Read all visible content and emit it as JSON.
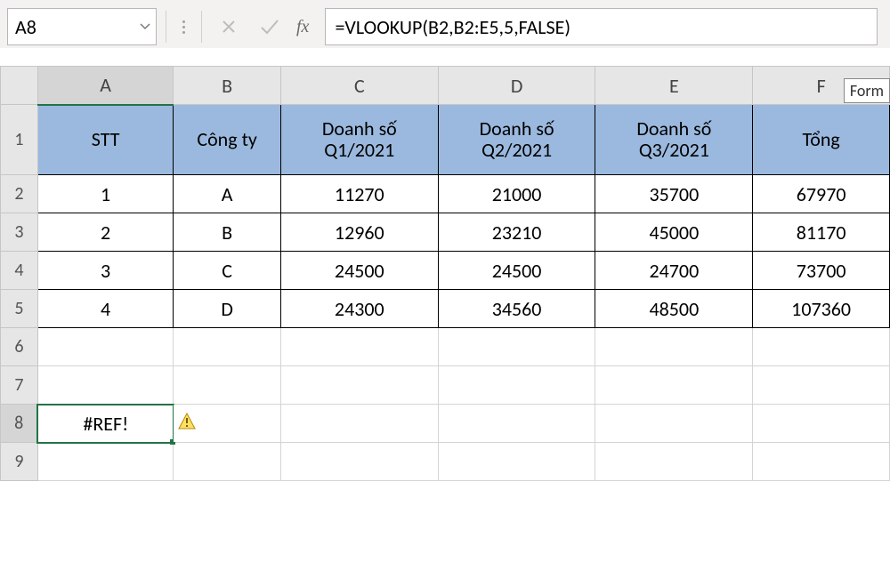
{
  "namebox": {
    "value": "A8"
  },
  "formula_bar": {
    "value": "=VLOOKUP(B2,B2:E5,5,FALSE)"
  },
  "floating_tag": "Form",
  "columns": [
    "A",
    "B",
    "C",
    "D",
    "E",
    "F"
  ],
  "row_numbers": [
    "1",
    "2",
    "3",
    "4",
    "5",
    "6",
    "7",
    "8",
    "9"
  ],
  "header_row": {
    "A": "STT",
    "B": "Công ty",
    "C": "Doanh số Q1/2021",
    "D": "Doanh số Q2/2021",
    "E": "Doanh số Q3/2021",
    "F": "Tổng"
  },
  "data_rows": [
    {
      "A": "1",
      "B": "A",
      "C": "11270",
      "D": "21000",
      "E": "35700",
      "F": "67970"
    },
    {
      "A": "2",
      "B": "B",
      "C": "12960",
      "D": "23210",
      "E": "45000",
      "F": "81170"
    },
    {
      "A": "3",
      "B": "C",
      "C": "24500",
      "D": "24500",
      "E": "24700",
      "F": "73700"
    },
    {
      "A": "4",
      "B": "D",
      "C": "24300",
      "D": "34560",
      "E": "48500",
      "F": "107360"
    }
  ],
  "error_cell": {
    "value": "#REF!"
  },
  "icons": {
    "fx_label": "fx"
  }
}
